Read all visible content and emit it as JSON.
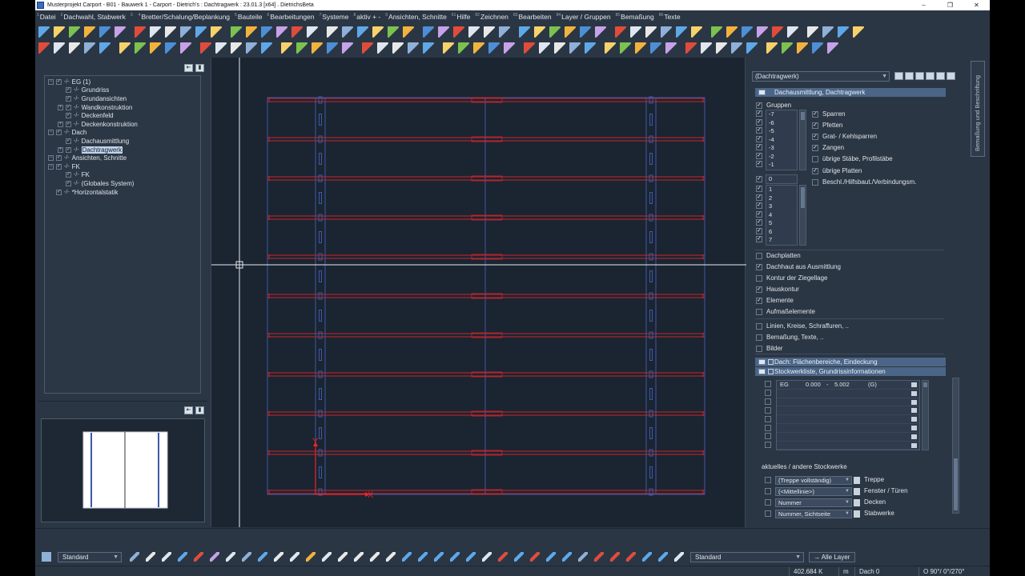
{
  "window": {
    "title": "Musterprojekt Carport - B01 - Bauwerk 1 - Carport - Dietrich's : Dachtragwerk : 23.01.3 [x64] .     DietrichsBeta",
    "minimize": "–",
    "maximize": "❐",
    "close": "✕"
  },
  "menu": [
    {
      "num": "1",
      "label": "Datei"
    },
    {
      "num": "2",
      "label": "Dachwahl, Stabwerk"
    },
    {
      "num": "3",
      "label": ""
    },
    {
      "num": "4",
      "label": "Bretter/Schalung/Beplankung"
    },
    {
      "num": "5",
      "label": "Bauteile"
    },
    {
      "num": "6",
      "label": "Bearbeitungen"
    },
    {
      "num": "7",
      "label": "Systeme"
    },
    {
      "num": "8",
      "label": "aktiv + -"
    },
    {
      "num": "9",
      "label": "Ansichten, Schnitte"
    },
    {
      "num": "61",
      "label": "Hilfe"
    },
    {
      "num": "82",
      "label": "Zeichnen"
    },
    {
      "num": "83",
      "label": "Bearbeiten"
    },
    {
      "num": "84",
      "label": "Layer / Gruppen"
    },
    {
      "num": "85",
      "label": "Bemaßung"
    },
    {
      "num": "86",
      "label": "Texte"
    }
  ],
  "tree": [
    {
      "indent": 0,
      "exp": "−",
      "check": "✓",
      "dash": true,
      "label": "EG (1)",
      "selected": false
    },
    {
      "indent": 1,
      "exp": "",
      "check": "✓",
      "dash": true,
      "label": "Grundriss",
      "selected": false
    },
    {
      "indent": 1,
      "exp": "",
      "check": "✓",
      "dash": true,
      "label": "Grundansichten",
      "selected": false
    },
    {
      "indent": 1,
      "exp": "+",
      "check": "✓",
      "dash": true,
      "label": "Wandkonstruktion",
      "selected": false
    },
    {
      "indent": 1,
      "exp": "",
      "check": "✓",
      "dash": true,
      "label": "Deckenfeld",
      "selected": false
    },
    {
      "indent": 1,
      "exp": "+",
      "check": "✓",
      "dash": true,
      "label": "Deckenkonstruktion",
      "selected": false
    },
    {
      "indent": 0,
      "exp": "−",
      "check": "✓",
      "dash": true,
      "label": "Dach",
      "selected": false
    },
    {
      "indent": 1,
      "exp": "",
      "check": "✓",
      "dash": true,
      "label": "Dachausmittlung",
      "selected": false
    },
    {
      "indent": 1,
      "exp": "+",
      "check": "✓",
      "dash": true,
      "label": "Dachtragwerk",
      "selected": true
    },
    {
      "indent": 0,
      "exp": "−",
      "check": "✓",
      "dash": true,
      "label": "Ansichten, Schnitte",
      "selected": false
    },
    {
      "indent": 0,
      "exp": "−",
      "check": "✓",
      "dash": true,
      "label": "FK",
      "selected": false
    },
    {
      "indent": 1,
      "exp": "",
      "check": "✓",
      "dash": true,
      "label": "FK",
      "selected": false
    },
    {
      "indent": 1,
      "exp": "",
      "check": "✓",
      "dash": true,
      "label": "(Globales System)",
      "selected": false
    },
    {
      "indent": 0,
      "exp": "",
      "check": "✓",
      "dash": true,
      "label": "*Horizontalstatik",
      "selected": false
    }
  ],
  "props": {
    "filter": "(Dachtragwerk)",
    "section_dach": "Dachausmittlung, Dachtragwerk",
    "groups_label": "Gruppen",
    "groups_checked": true,
    "neg_list": [
      "-7",
      "-6",
      "-5",
      "-4",
      "-3",
      "-2",
      "-1"
    ],
    "zero": "0",
    "pos_list": [
      "1",
      "2",
      "3",
      "4",
      "5",
      "6",
      "7"
    ],
    "member_types": [
      {
        "label": "Sparren",
        "checked": true
      },
      {
        "label": "Pfetten",
        "checked": true
      },
      {
        "label": "Grat- / Kehlsparren",
        "checked": true
      },
      {
        "label": "Zangen",
        "checked": true
      },
      {
        "label": "übrige Stäbe, Profilstäbe",
        "checked": false
      },
      {
        "label": "übrige Platten",
        "checked": true
      },
      {
        "label": "Beschl./Hilfsbaut./Verbindungsm.",
        "checked": false
      }
    ],
    "options_a": [
      {
        "label": "Dachplatten",
        "checked": false
      },
      {
        "label": "Dachhaut aus Ausmittlung",
        "checked": true
      },
      {
        "label": "Kontur der Ziegellage",
        "checked": false
      },
      {
        "label": "Hauskontur",
        "checked": true
      },
      {
        "label": "Elemente",
        "checked": true
      },
      {
        "label": "Aufmaßelemente",
        "checked": false
      }
    ],
    "options_b": [
      {
        "label": "Linien, Kreise, Schraffuren, ..",
        "checked": false
      },
      {
        "label": "Bemaßung, Texte, ..",
        "checked": false
      },
      {
        "label": "Bilder",
        "checked": false
      }
    ],
    "section_flaechen": "Dach: Flächenbereiche, Eindeckung",
    "section_stockwerk": "Stockwerkliste, Grundrissinformationen",
    "storey_row": {
      "name": "EG",
      "from": "0.000",
      "sep": "-",
      "to": "5.002",
      "tag": "(G)"
    },
    "current_storey_label": "aktuelles / andere Stockwerke",
    "storey_rows": [
      {
        "value": "(Treppe vollständig)",
        "label": "Treppe"
      },
      {
        "value": "(<Mittellinie>)",
        "label": "Fenster / Türen"
      },
      {
        "value": "Nummer",
        "label": "Decken"
      },
      {
        "value": "Nummer, Sichtseite",
        "label": "Stabwerke"
      }
    ]
  },
  "side_tab": "Bemaßung und Beschriftung",
  "bottom_toolbar": {
    "style_select": "Standard",
    "layer_style_select": "Standard",
    "layer_select": "→ Alle Layer"
  },
  "status": {
    "zoom": "402.684 K",
    "unit": "m",
    "level": "Dach 0",
    "angle": "O 90°/   0°/270°"
  },
  "canvas": {
    "axis_x_label": "X",
    "axis_y_label": "Y",
    "rafter_count": 11
  },
  "colors": {
    "rafter": "#c8262c",
    "plate": "#3c5aa8",
    "axis": "#e8252b",
    "crosshair": "#e8ecf0"
  }
}
